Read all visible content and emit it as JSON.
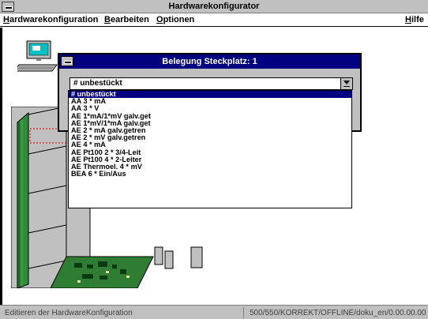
{
  "window": {
    "title": "Hardwarekonfigurator"
  },
  "menu": {
    "items": [
      {
        "label": "Hardwarekonfiguration",
        "mnemonic": "H"
      },
      {
        "label": "Bearbeiten",
        "mnemonic": "B"
      },
      {
        "label": "Optionen",
        "mnemonic": "O"
      },
      {
        "label": "Hilfe",
        "mnemonic": "H"
      }
    ]
  },
  "dialog": {
    "title": "Belegung Steckplatz: 1",
    "combo_value": "# unbestückt",
    "options": [
      "# unbestückt",
      "AA 3 * mA",
      "AA 3 * V",
      "AE 1*mA/1*mV galv.get",
      "AE 1*mV/1*mA galv.get",
      "AE 2 * mA galv.getren",
      "AE 2 * mV galv.getren",
      "AE 4 * mA",
      "AE Pt100 2 * 3/4-Leit",
      "AE Pt100 4 * 2-Leiter",
      "AE Thermoel. 4 * mV",
      "BEA 6 * Ein/Aus"
    ],
    "selected_index": 0
  },
  "statusbar": {
    "left": "Editieren der HardwareKonfiguration",
    "right": "500/550/KORREKT/OFFLINE/doku_en/0.00.00.00"
  },
  "colors": {
    "titlebar_active": "#000080",
    "chrome_gray": "#c0c0c0",
    "rack_green": "#1a8a2a",
    "board_green": "#2e7d32"
  }
}
